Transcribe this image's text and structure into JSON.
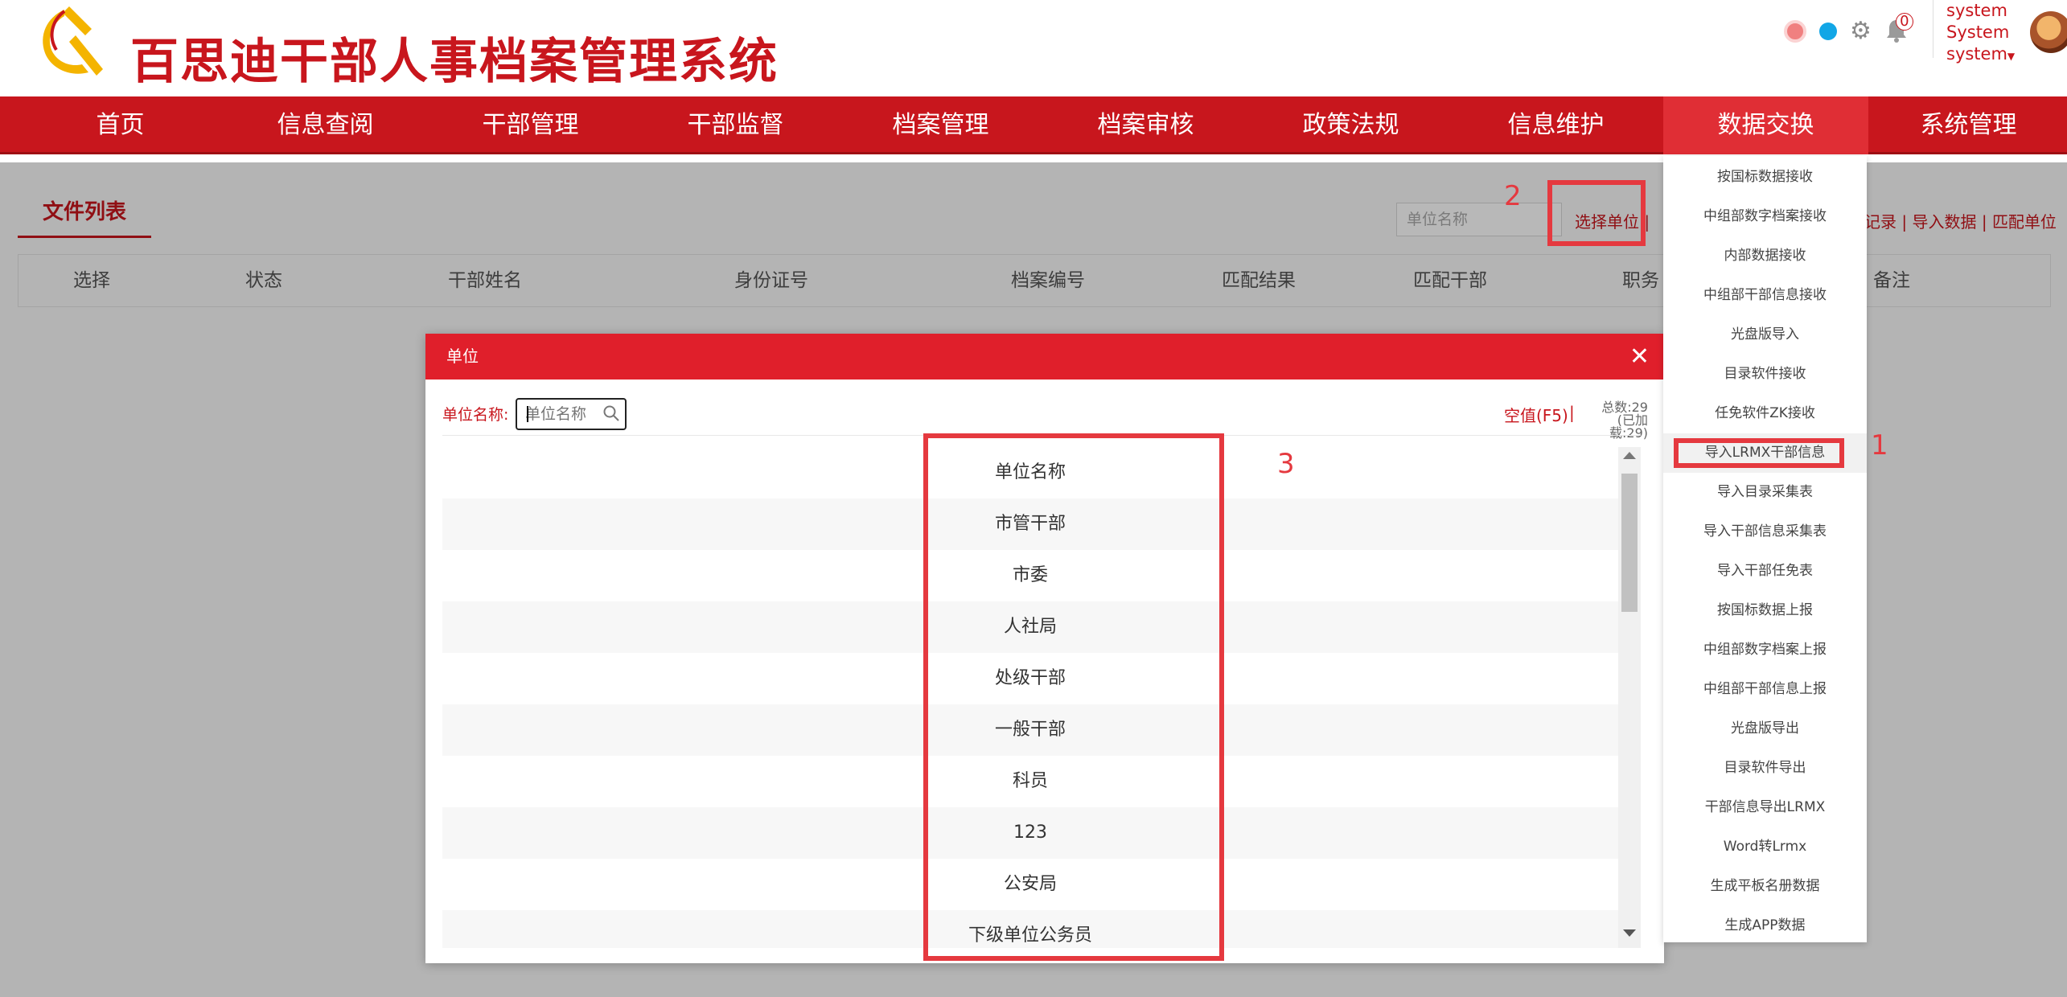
{
  "header": {
    "title": "百思迪干部人事档案管理系统",
    "notification_count": "0",
    "user_lines": [
      "system",
      "System",
      "system"
    ],
    "icons": [
      "party-emblem-icon",
      "record-dot-icon",
      "status-dot-icon",
      "gear-icon",
      "bell-icon",
      "caret-down-icon",
      "avatar"
    ]
  },
  "nav": {
    "items": [
      "首页",
      "信息查阅",
      "干部管理",
      "干部监督",
      "档案管理",
      "档案审核",
      "政策法规",
      "信息维护",
      "数据交换",
      "系统管理"
    ],
    "active": "数据交换"
  },
  "page": {
    "tab": "文件列表",
    "filter_placeholder": "单位名称",
    "select_unit": "选择单位",
    "right_links": [
      "记录",
      "导入数据",
      "匹配单位"
    ],
    "separator": "|",
    "columns": [
      "选择",
      "状态",
      "干部姓名",
      "身份证号",
      "档案编号",
      "匹配结果",
      "匹配干部",
      "职务",
      "备注"
    ]
  },
  "modal": {
    "title": "单位",
    "search_label": "单位名称:",
    "search_placeholder": "单位名称",
    "null_button": "空值(F5)",
    "separator": "|",
    "total": "总数:29",
    "loaded": "(已加载:29)",
    "rows": [
      "单位名称",
      "市管干部",
      "市委",
      "人社局",
      "处级干部",
      "一般干部",
      "科员",
      "123",
      "公安局",
      "下级单位公务员"
    ]
  },
  "dropdown": {
    "items": [
      "按国标数据接收",
      "中组部数字档案接收",
      "内部数据接收",
      "中组部干部信息接收",
      "光盘版导入",
      "目录软件接收",
      "任免软件ZK接收",
      "导入LRMX干部信息",
      "导入目录采集表",
      "导入干部信息采集表",
      "导入干部任免表",
      "按国标数据上报",
      "中组部数字档案上报",
      "中组部干部信息上报",
      "光盘版导出",
      "目录软件导出",
      "干部信息导出LRMX",
      "Word转Lrmx",
      "生成平板名册数据",
      "生成APP数据"
    ],
    "highlighted": "导入LRMX干部信息"
  },
  "annotations": [
    "1",
    "2",
    "3"
  ],
  "colors": {
    "brand_red": "#c8161d",
    "modal_header": "#e01f2b",
    "annotation_red": "#e5393f",
    "active_nav": "#e02e35"
  }
}
